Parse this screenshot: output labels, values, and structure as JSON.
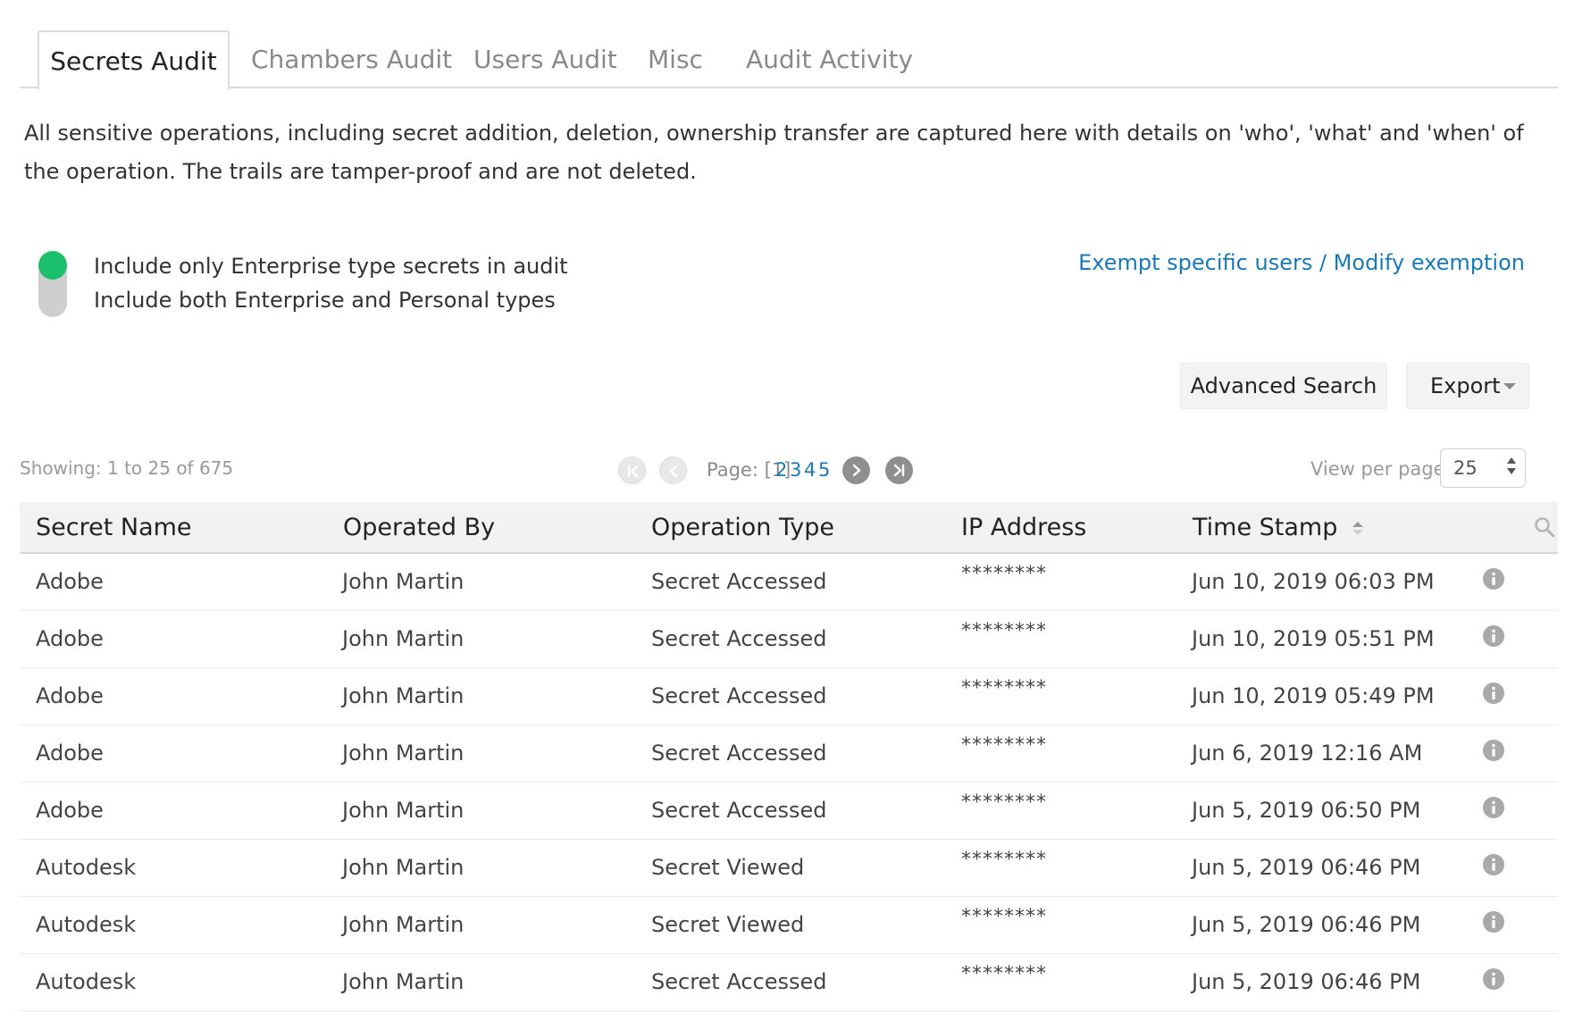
{
  "tabs": [
    {
      "label": "Secrets Audit",
      "active": true
    },
    {
      "label": "Chambers Audit",
      "active": false
    },
    {
      "label": "Users Audit",
      "active": false
    },
    {
      "label": "Misc",
      "active": false
    },
    {
      "label": "Audit Activity",
      "active": false
    }
  ],
  "description": "All sensitive operations, including secret addition, deletion, ownership transfer are captured here with details on 'who', 'what' and 'when' of the operation. The trails are tamper-proof and are not deleted.",
  "toggle": {
    "option_on": "Include only Enterprise type secrets in audit",
    "option_off": "Include both Enterprise and Personal types",
    "state": "on",
    "color": "#1cbf6c"
  },
  "exempt_link": "Exempt specific users / Modify exemption",
  "toolbar": {
    "advanced_search": "Advanced Search",
    "export": "Export"
  },
  "pagination": {
    "showing": "Showing: 1 to 25 of 675",
    "page_label": "Page: [1]",
    "pages": [
      "2",
      "3",
      "4",
      "5"
    ],
    "view_per_page_label": "View per page",
    "view_per_page_value": "25"
  },
  "table": {
    "columns": [
      "Secret Name",
      "Operated By",
      "Operation Type",
      "IP Address",
      "Time Stamp"
    ],
    "rows": [
      {
        "secret": "Adobe",
        "by": "John Martin",
        "op": "Secret Accessed",
        "ip": "********",
        "time": "Jun 10, 2019 06:03 PM"
      },
      {
        "secret": "Adobe",
        "by": "John Martin",
        "op": "Secret Accessed",
        "ip": "********",
        "time": "Jun 10, 2019 05:51 PM"
      },
      {
        "secret": "Adobe",
        "by": "John Martin",
        "op": "Secret Accessed",
        "ip": "********",
        "time": "Jun 10, 2019 05:49 PM"
      },
      {
        "secret": "Adobe",
        "by": "John Martin",
        "op": "Secret Accessed",
        "ip": "********",
        "time": "Jun 6, 2019 12:16 AM"
      },
      {
        "secret": "Adobe",
        "by": "John Martin",
        "op": "Secret Accessed",
        "ip": "********",
        "time": "Jun 5, 2019 06:50 PM"
      },
      {
        "secret": "Autodesk",
        "by": "John Martin",
        "op": "Secret Viewed",
        "ip": "********",
        "time": "Jun 5, 2019 06:46 PM"
      },
      {
        "secret": "Autodesk",
        "by": "John Martin",
        "op": "Secret Viewed",
        "ip": "********",
        "time": "Jun 5, 2019 06:46 PM"
      },
      {
        "secret": "Autodesk",
        "by": "John Martin",
        "op": "Secret Accessed",
        "ip": "********",
        "time": "Jun 5, 2019 06:46 PM"
      }
    ]
  },
  "colors": {
    "link": "#1b78b4",
    "accent_green": "#1cbf6c"
  },
  "icons": [
    "first-page-icon",
    "prev-page-icon",
    "next-page-icon",
    "last-page-icon",
    "search-icon",
    "info-icon",
    "sort-icon",
    "caret-down-icon"
  ]
}
